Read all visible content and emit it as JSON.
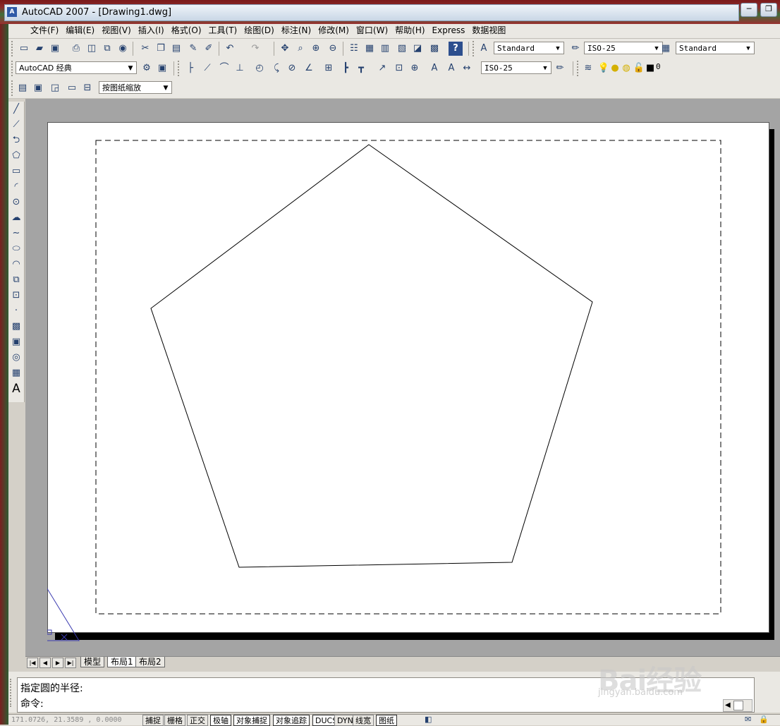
{
  "window": {
    "title": "AutoCAD 2007 - [Drawing1.dwg]",
    "icon_text": "A",
    "minimize_symbol": "─",
    "restore_symbol": "❐"
  },
  "menu": [
    "文件(F)",
    "编辑(E)",
    "视图(V)",
    "插入(I)",
    "格式(O)",
    "工具(T)",
    "绘图(D)",
    "标注(N)",
    "修改(M)",
    "窗口(W)",
    "帮助(H)",
    "Express",
    "数据视图"
  ],
  "toolbar": {
    "text_style": "Standard",
    "dim_style": "ISO-25",
    "table_style": "Standard",
    "workspace": "AutoCAD 经典",
    "dim_style2": "ISO-25",
    "layer_name": "0",
    "viewport_scale": "按图纸缩放"
  },
  "icons": {
    "row1": [
      "new-icon",
      "open-icon",
      "save-icon",
      "plot-icon",
      "plot-preview-icon",
      "publish-icon",
      "3dwf-icon",
      "cut-icon",
      "copy-icon",
      "paste-icon",
      "match-properties-icon",
      "block-editor-icon",
      "undo-icon",
      "redo-icon",
      "pan-icon",
      "zoom-realtime-icon",
      "zoom-window-icon",
      "zoom-previous-icon",
      "properties-icon",
      "design-center-icon",
      "tool-palettes-icon",
      "sheet-set-icon",
      "markup-icon",
      "calculator-icon",
      "help-icon"
    ],
    "draw": [
      "line-icon",
      "construction-line-icon",
      "polyline-icon",
      "polygon-icon",
      "rectangle-icon",
      "arc-icon",
      "circle-icon",
      "revision-cloud-icon",
      "spline-icon",
      "ellipse-icon",
      "ellipse-arc-icon",
      "insert-block-icon",
      "make-block-icon",
      "point-icon",
      "hatch-icon",
      "gradient-icon",
      "region-icon",
      "table-icon",
      "multiline-text-icon"
    ]
  },
  "tabs": [
    "模型",
    "布局1",
    "布局2"
  ],
  "active_tab": "布局1",
  "command": {
    "history": "指定圆的半径:",
    "prompt": "命令:"
  },
  "status": {
    "coords": "171.0726, 21.3589 , 0.0000",
    "buttons": [
      "捕捉",
      "栅格",
      "正交",
      "极轴",
      "对象捕捉",
      "对象追踪",
      "DUCS",
      "DYN",
      "线宽",
      "图纸"
    ]
  },
  "watermark": {
    "text": "Bai经验",
    "url": "jingyan.baidu.com"
  }
}
